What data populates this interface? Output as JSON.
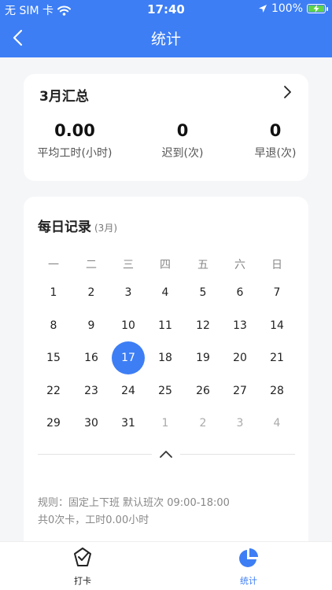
{
  "status_bar": {
    "carrier": "无 SIM 卡",
    "time": "17:40",
    "battery": "100%"
  },
  "nav": {
    "title": "统计"
  },
  "summary": {
    "title": "3月汇总",
    "stats": [
      {
        "value": "0.00",
        "label": "平均工时(小时)"
      },
      {
        "value": "0",
        "label": "迟到(次)"
      },
      {
        "value": "0",
        "label": "早退(次)"
      }
    ]
  },
  "daily": {
    "title": "每日记录",
    "subtitle": "(3月)",
    "weekdays": [
      "一",
      "二",
      "三",
      "四",
      "五",
      "六",
      "日"
    ],
    "weeks": [
      [
        "1",
        "2",
        "3",
        "4",
        "5",
        "6",
        "7"
      ],
      [
        "8",
        "9",
        "10",
        "11",
        "12",
        "13",
        "14"
      ],
      [
        "15",
        "16",
        "17",
        "18",
        "19",
        "20",
        "21"
      ],
      [
        "22",
        "23",
        "24",
        "25",
        "26",
        "27",
        "28"
      ],
      [
        "29",
        "30",
        "31",
        "1",
        "2",
        "3",
        "4"
      ]
    ],
    "selected_day": "17",
    "rule_line1": "规则：固定上下班 默认班次 09:00-18:00",
    "rule_line2": "共0次卡，工时0.00小时"
  },
  "tabbar": {
    "items": [
      {
        "label": "打卡",
        "icon": "check-shield-icon",
        "active": false
      },
      {
        "label": "统计",
        "icon": "pie-chart-icon",
        "active": true
      }
    ]
  },
  "colors": {
    "accent": "#3d7ef5",
    "background": "#f5f6f8",
    "battery": "#5fd34a"
  }
}
